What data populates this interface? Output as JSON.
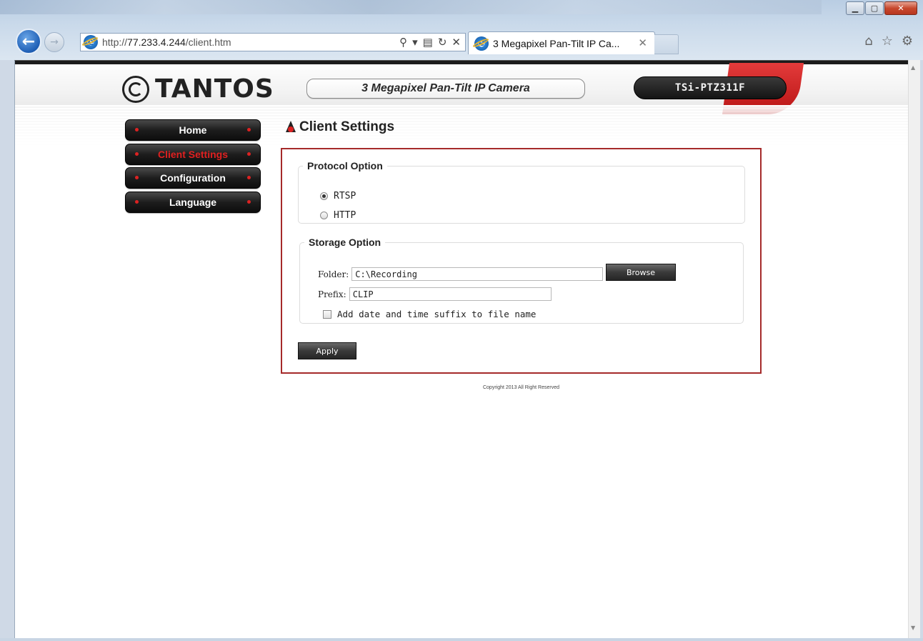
{
  "browser": {
    "url_prefix": "http://",
    "url_host": "77.233.4.244",
    "url_path": "/client.htm",
    "tab_title": "3 Megapixel Pan-Tilt IP Ca...",
    "window_controls": [
      "minimize-icon",
      "maximize-icon",
      "close-icon"
    ],
    "toolbar_icons": [
      "home-icon",
      "favorites-star-icon",
      "tools-gear-icon"
    ]
  },
  "header": {
    "brand": "TANTOS",
    "product": "3 Megapixel Pan-Tilt IP Camera",
    "model": "TSi-PTZ311F"
  },
  "nav": {
    "items": [
      {
        "label": "Home",
        "active": false
      },
      {
        "label": "Client Settings",
        "active": true
      },
      {
        "label": "Configuration",
        "active": false
      },
      {
        "label": "Language",
        "active": false
      }
    ]
  },
  "page": {
    "title": "Client Settings",
    "protocol": {
      "legend": "Protocol Option",
      "options": [
        "RTSP",
        "HTTP"
      ],
      "selected": "RTSP"
    },
    "storage": {
      "legend": "Storage Option",
      "folder_label": "Folder:",
      "folder_value": "C:\\Recording",
      "browse_label": "Browse",
      "prefix_label": "Prefix:",
      "prefix_value": "CLIP",
      "suffix_label": "Add date and time suffix to file name",
      "suffix_checked": false
    },
    "apply_label": "Apply",
    "copyright": "Copyright 2013 All Right Reserved"
  },
  "colors": {
    "accent_red": "#a52a2a",
    "nav_active_text": "#e02020",
    "nav_bg": "#1d1d1d"
  }
}
